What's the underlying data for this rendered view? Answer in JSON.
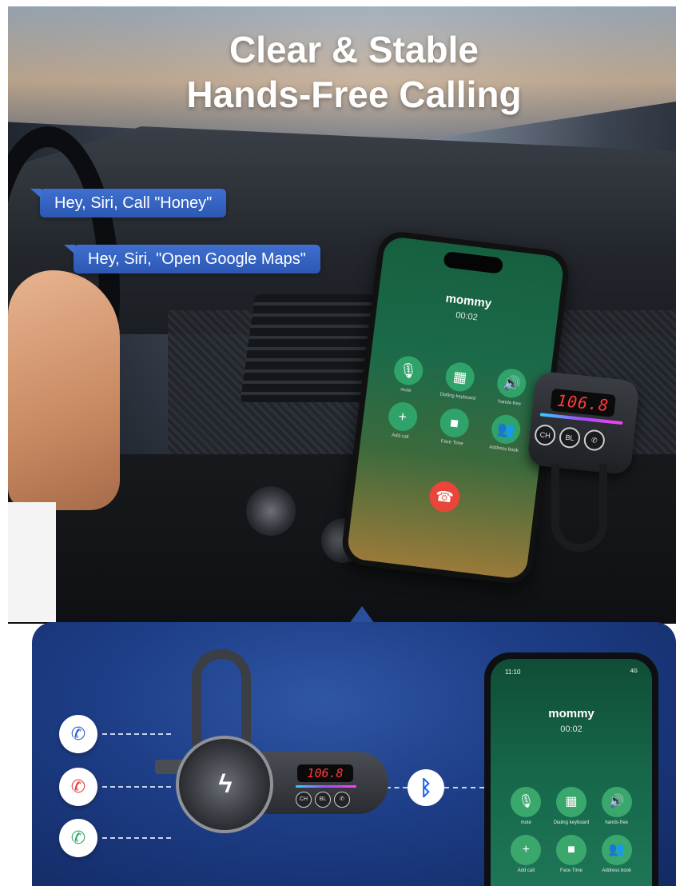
{
  "headline": {
    "line1": "Clear & Stable",
    "line2": "Hands-Free Calling"
  },
  "voice_bubbles": [
    "Hey, Siri, Call \"Honey\"",
    "Hey, Siri, \"Open Google Maps\""
  ],
  "scene_phone": {
    "caller_name": "mommy",
    "call_timer": "00:02",
    "controls": [
      "mute",
      "Dialing keyboard",
      "hands-free",
      "Add call",
      "Face Time",
      "Address book"
    ]
  },
  "fm_transmitter": {
    "frequency": "106.8",
    "buttons": [
      "CH",
      "BL",
      "call"
    ]
  },
  "call_status_icons": [
    "incoming-call-icon",
    "decline-call-icon",
    "answer-call-icon"
  ],
  "connection_icon": "bluetooth-icon",
  "detail_phone": {
    "status_time": "11:10",
    "status_right": "4G",
    "caller_name": "mommy",
    "call_timer": "00:02",
    "controls": [
      "mute",
      "Dialing keyboard",
      "hands-free",
      "Add call",
      "Face Time",
      "Address book"
    ]
  },
  "colors": {
    "bubble_blue": "#3f6fcf",
    "panel_blue": "#1d3d86",
    "call_green": "#3aa86d",
    "hangup_red": "#e9453a",
    "display_red": "#ff3939"
  }
}
